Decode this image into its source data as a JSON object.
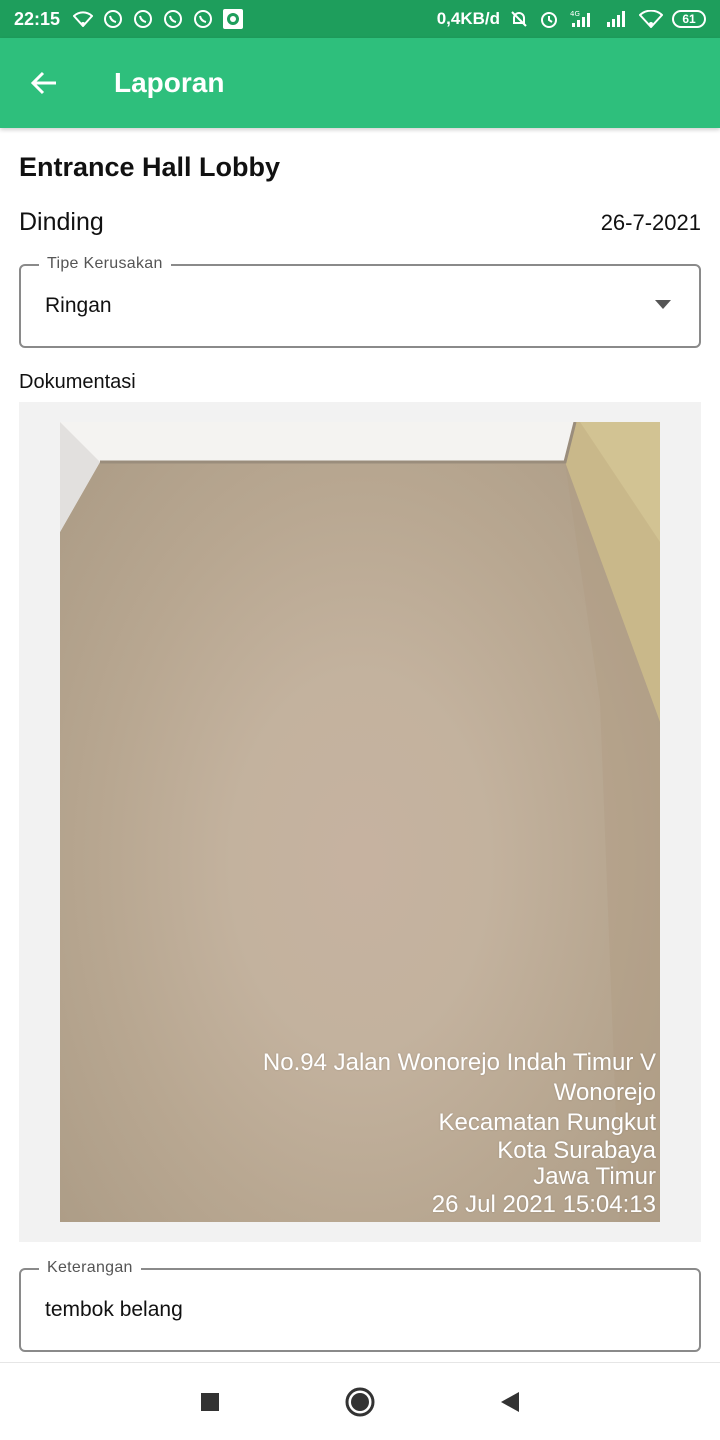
{
  "status_bar": {
    "time": "22:15",
    "left_icons": [
      "wifi-icon",
      "whatsapp-icon",
      "whatsapp-icon",
      "whatsapp-icon",
      "whatsapp-icon",
      "camera-app-icon"
    ],
    "speed": "0,4KB/d",
    "right_icons": [
      "silent-icon",
      "alarm-icon",
      "signal-4g-icon",
      "signal-icon",
      "wifi-icon"
    ],
    "battery": "61",
    "network_type": "4G"
  },
  "app_bar": {
    "title": "Laporan",
    "color": "#2ebf7c"
  },
  "report": {
    "location": "Entrance Hall Lobby",
    "component": "Dinding",
    "date": "26-7-2021"
  },
  "damage_type": {
    "label": "Tipe Kerusakan",
    "value": "Ringan"
  },
  "documentation": {
    "label": "Dokumentasi",
    "watermark": {
      "line1": "No.94 Jalan Wonorejo Indah Timur V",
      "line2": "Wonorejo",
      "line3": "Kecamatan Rungkut",
      "line4": "Kota Surabaya",
      "line5": "Jawa Timur",
      "line6": "26 Jul 2021 15:04:13"
    }
  },
  "notes": {
    "label": "Keterangan",
    "value": "tembok belang"
  },
  "colors": {
    "status_bar": "#1e9e5c",
    "accent": "#2ebf7c"
  }
}
